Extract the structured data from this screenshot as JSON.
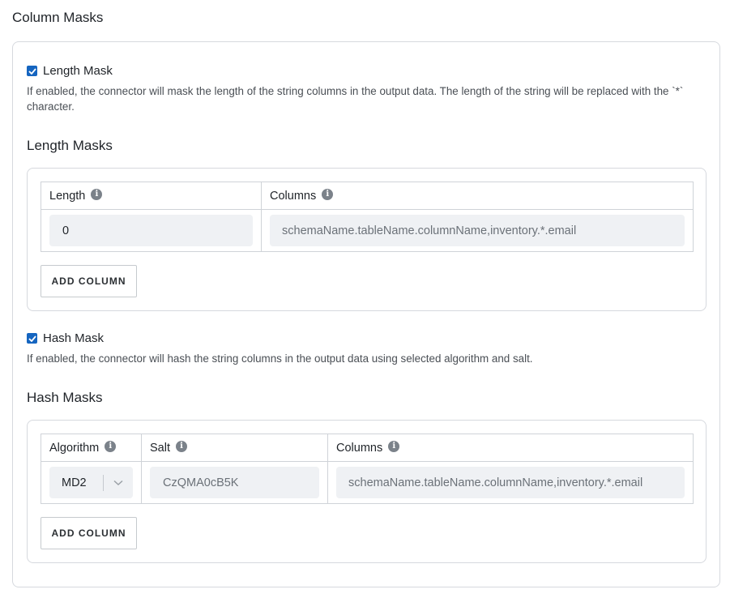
{
  "page": {
    "title": "Column Masks"
  },
  "length_mask": {
    "checkbox_label": "Length Mask",
    "checked": true,
    "help": "If enabled, the connector will mask the length of the string columns in the output data. The length of the string will be replaced with the `*` character.",
    "section_title": "Length Masks",
    "headers": {
      "length": "Length",
      "columns": "Columns"
    },
    "row": {
      "length_value": "0",
      "columns_placeholder": "schemaName.tableName.columnName,inventory.*.email"
    },
    "add_button": "ADD COLUMN"
  },
  "hash_mask": {
    "checkbox_label": "Hash Mask",
    "checked": true,
    "help": "If enabled, the connector will hash the string columns in the output data using selected algorithm and salt.",
    "section_title": "Hash Masks",
    "headers": {
      "algorithm": "Algorithm",
      "salt": "Salt",
      "columns": "Columns"
    },
    "row": {
      "algorithm_value": "MD2",
      "salt_placeholder": "CzQMA0cB5K",
      "columns_placeholder": "schemaName.tableName.columnName,inventory.*.email"
    },
    "add_button": "ADD COLUMN"
  },
  "icons": {
    "checkbox_color": "#1565c0",
    "info": "info-icon",
    "chevron": "chevron-down-icon"
  }
}
